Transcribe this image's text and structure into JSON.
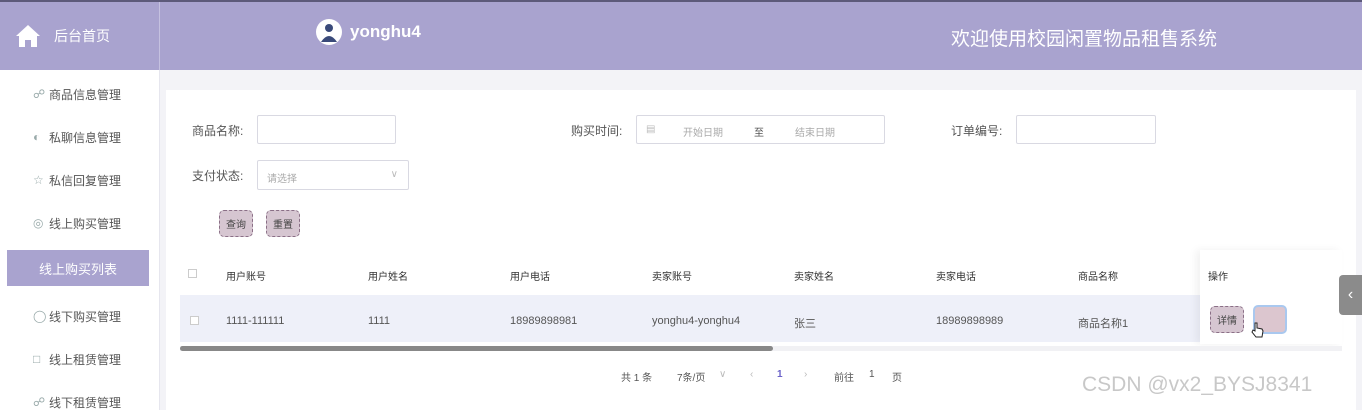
{
  "header": {
    "home_label": "后台首页",
    "username": "yonghu4",
    "welcome": "欢迎使用校园闲置物品租售系统"
  },
  "sidebar": {
    "items": [
      {
        "label": "商品信息管理",
        "icon": "gift-icon"
      },
      {
        "label": "私聊信息管理",
        "icon": "chat-icon"
      },
      {
        "label": "私信回复管理",
        "icon": "star-icon"
      },
      {
        "label": "线上购买管理",
        "icon": "compass-icon"
      },
      {
        "label": "线上购买列表",
        "icon": ""
      },
      {
        "label": "线下购买管理",
        "icon": "bag-icon"
      },
      {
        "label": "线上租赁管理",
        "icon": "calendar-icon"
      },
      {
        "label": "线下租赁管理",
        "icon": "gift-icon"
      }
    ],
    "active_index": 4
  },
  "search": {
    "product_name_label": "商品名称:",
    "product_name_value": "",
    "purchase_time_label": "购买时间:",
    "start_placeholder": "开始日期",
    "range_separator": "至",
    "end_placeholder": "结束日期",
    "order_no_label": "订单编号:",
    "order_no_value": "",
    "pay_status_label": "支付状态:",
    "pay_status_placeholder": "请选择",
    "query_button": "查询",
    "reset_button": "重置"
  },
  "table": {
    "columns": [
      "用户账号",
      "用户姓名",
      "用户电话",
      "卖家账号",
      "卖家姓名",
      "卖家电话",
      "商品名称",
      "操作"
    ],
    "rows": [
      {
        "user_account": "1111-111111",
        "user_name": "1111",
        "user_phone": "18989898981",
        "seller_account": "yonghu4-yonghu4",
        "seller_name": "张三",
        "seller_phone": "18989898989",
        "product_name": "商品名称1",
        "detail_button": "详情"
      }
    ]
  },
  "pagination": {
    "total": "共 1 条",
    "page_size": "7条/页",
    "current_page": "1",
    "goto_label": "前往",
    "goto_value": "1",
    "page_suffix": "页"
  },
  "watermark": "CSDN @vx2_BYSJ8341",
  "colors": {
    "header_bg": "#a9a3cf",
    "active_menu_bg": "#a9a3cf",
    "button_bg": "#d6c6d1",
    "accent": "#6b62c9"
  }
}
